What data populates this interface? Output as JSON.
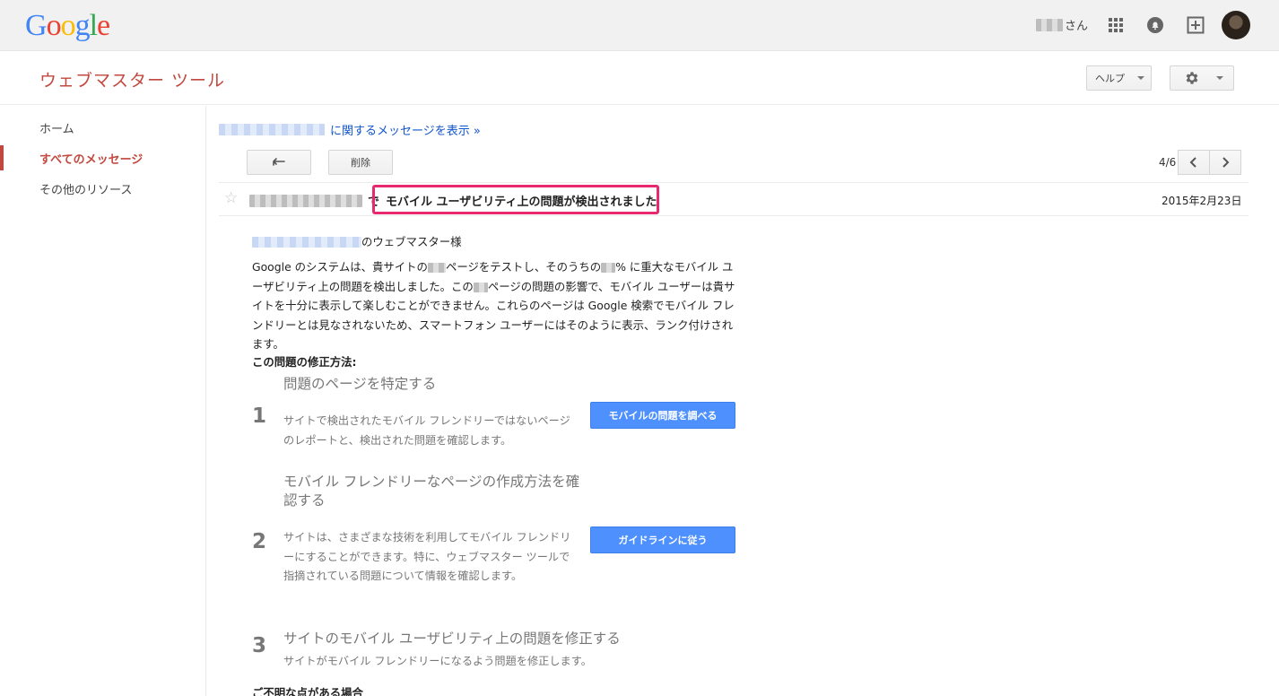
{
  "gbar": {
    "logo": [
      "G",
      "o",
      "o",
      "g",
      "l",
      "e"
    ],
    "user_suffix": "さん"
  },
  "header": {
    "title": "ウェブマスター ツール",
    "help_label": "ヘルプ"
  },
  "sidebar": {
    "items": [
      {
        "label": "ホーム"
      },
      {
        "label": "すべてのメッセージ"
      },
      {
        "label": "その他のリソース"
      }
    ]
  },
  "main": {
    "view_link": "に関するメッセージを表示 »",
    "delete_label": "削除",
    "count": "4/6",
    "subject_prefix": "で",
    "subject": "モバイル ユーザビリティ上の問題が検出されました",
    "date": "2015年2月23日",
    "greeting": "のウェブマスター様",
    "para_a": "Google のシステムは、貴サイトの",
    "para_b": "ページをテストし、そのうちの",
    "para_c": "% に重大なモバイル ユーザビリティ上の問題を検出しました。この",
    "para_d": "ページの問題の影響で、モバイル ユーザーは貴サイトを十分に表示して楽しむことができません。これらのページは Google 検索でモバイル フレンドリーとは見なされないため、スマートフォン ユーザーにはそのように表示、ランク付けされます。",
    "fix_heading": "この問題の修正方法:",
    "steps": [
      {
        "num": "1",
        "title": "問題のページを特定する",
        "text": "サイトで検出されたモバイル フレンドリーではないページのレポートと、検出された問題を確認します。",
        "button": "モバイルの問題を調べる"
      },
      {
        "num": "2",
        "title": "モバイル フレンドリーなページの作成方法を確認する",
        "text": "サイトは、さまざまな技術を利用してモバイル フレンドリーにすることができます。特に、ウェブマスター ツールで指摘されている問題について情報を確認します。",
        "button": "ガイドラインに従う"
      },
      {
        "num": "3",
        "title": "サイトのモバイル ユーザビリティ上の問題を修正する",
        "text": "サイトがモバイル フレンドリーになるよう問題を修正します。"
      }
    ],
    "footer_heading": "ご不明な点がある場合"
  }
}
